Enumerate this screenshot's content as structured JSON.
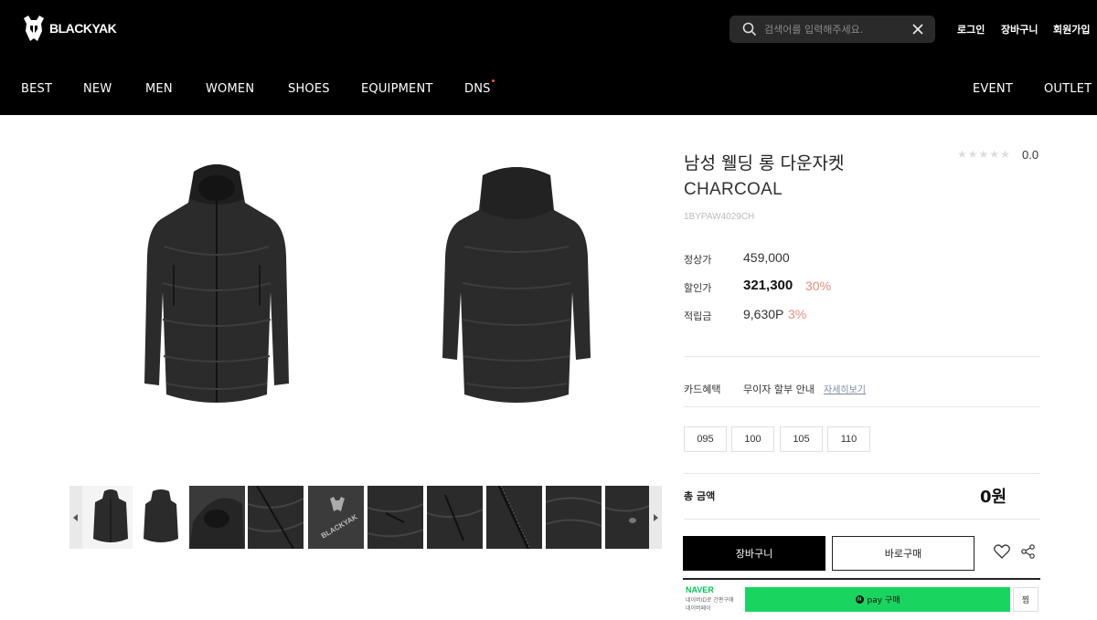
{
  "header": {
    "brand": "BLACKYAK",
    "search_placeholder": "검색어를 입력해주세요.",
    "util_links": [
      "로그인",
      "장바구니",
      "회원가입"
    ],
    "nav_left": [
      "BEST",
      "NEW",
      "MEN",
      "WOMEN",
      "SHOES",
      "EQUIPMENT",
      "DNS"
    ],
    "nav_right": [
      "EVENT",
      "OUTLET"
    ]
  },
  "product": {
    "name": "남성 웰딩 롱 다운자켓",
    "color": "CHARCOAL",
    "code": "1BYPAW4029CH",
    "rating": "0.0",
    "rating_stars": 0,
    "regular_label": "정상가",
    "regular_price": "459,000",
    "sale_label": "할인가",
    "sale_price": "321,300",
    "sale_pct": "30%",
    "points_label": "적립금",
    "points": "9,630P",
    "points_pct": "3%",
    "card_label": "카드혜택",
    "card_text": "무이자 할부 안내",
    "card_link": "자세히보기",
    "sizes": [
      "095",
      "100",
      "105",
      "110"
    ],
    "total_label": "총 금액",
    "total_value": "0원",
    "cart_label": "장바구니",
    "buy_label": "바로구매"
  },
  "gallery": {
    "thumbnail_count": 10,
    "thumb_logo_text": "BLACKYAK"
  },
  "naver": {
    "logo": "NAVER",
    "sub1": "네이버ID로 간편구매",
    "sub2": "네이버페이",
    "pay_label": "pay 구매",
    "pay_mark": "N",
    "zzim_label": "찜"
  },
  "colors": {
    "header_bg": "#000000",
    "discount": "#e38e7e",
    "npay_green": "#19d55f",
    "naver_green": "#03c75a"
  }
}
